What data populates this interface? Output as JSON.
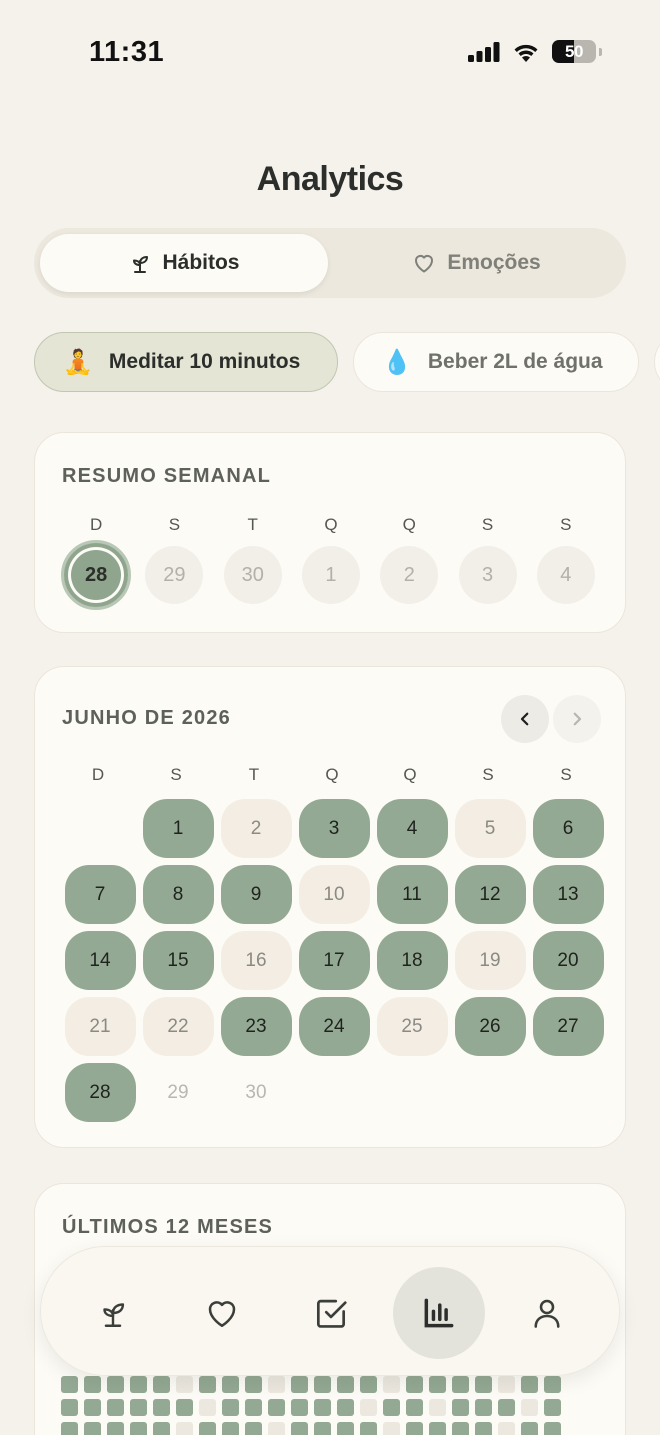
{
  "status_bar": {
    "time": "11:31",
    "battery": "50"
  },
  "page_title": "Analytics",
  "segmented": {
    "habits_label": "Hábitos",
    "emotions_label": "Emoções"
  },
  "chips": [
    {
      "emoji": "🧘",
      "label": "Meditar 10 minutos"
    },
    {
      "emoji": "💧",
      "label": "Beber 2L de água"
    }
  ],
  "weekly": {
    "title": "RESUMO SEMANAL",
    "weekday_headers": [
      "D",
      "S",
      "T",
      "Q",
      "Q",
      "S",
      "S"
    ],
    "days": [
      "28",
      "29",
      "30",
      "1",
      "2",
      "3",
      "4"
    ]
  },
  "month": {
    "title": "JUNHO DE 2026",
    "weekday_headers": [
      "D",
      "S",
      "T",
      "Q",
      "Q",
      "S",
      "S"
    ],
    "days": [
      {
        "n": "",
        "s": "empty"
      },
      {
        "n": "1",
        "s": "done"
      },
      {
        "n": "2",
        "s": "missed"
      },
      {
        "n": "3",
        "s": "done"
      },
      {
        "n": "4",
        "s": "done"
      },
      {
        "n": "5",
        "s": "missed"
      },
      {
        "n": "6",
        "s": "done"
      },
      {
        "n": "7",
        "s": "done"
      },
      {
        "n": "8",
        "s": "done"
      },
      {
        "n": "9",
        "s": "done"
      },
      {
        "n": "10",
        "s": "missed"
      },
      {
        "n": "11",
        "s": "done"
      },
      {
        "n": "12",
        "s": "done"
      },
      {
        "n": "13",
        "s": "done"
      },
      {
        "n": "14",
        "s": "done"
      },
      {
        "n": "15",
        "s": "done"
      },
      {
        "n": "16",
        "s": "missed"
      },
      {
        "n": "17",
        "s": "done"
      },
      {
        "n": "18",
        "s": "done"
      },
      {
        "n": "19",
        "s": "missed"
      },
      {
        "n": "20",
        "s": "done"
      },
      {
        "n": "21",
        "s": "missed"
      },
      {
        "n": "22",
        "s": "missed"
      },
      {
        "n": "23",
        "s": "done"
      },
      {
        "n": "24",
        "s": "done"
      },
      {
        "n": "25",
        "s": "missed"
      },
      {
        "n": "26",
        "s": "done"
      },
      {
        "n": "27",
        "s": "done"
      },
      {
        "n": "28",
        "s": "done"
      },
      {
        "n": "29",
        "s": "future"
      },
      {
        "n": "30",
        "s": "future"
      }
    ]
  },
  "yearly": {
    "title": "ÚLTIMOS 12 MESES"
  },
  "bottom_nav": [
    "habits",
    "emotions",
    "tasks",
    "analytics",
    "profile"
  ]
}
